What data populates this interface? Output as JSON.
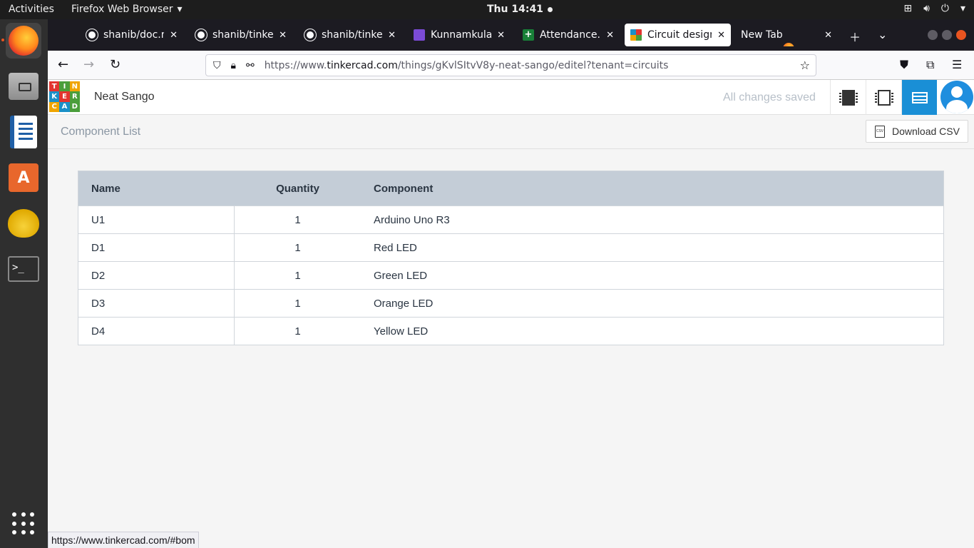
{
  "gnome": {
    "activities": "Activities",
    "app_name": "Firefox Web Browser",
    "clock": "Thu 14:41"
  },
  "tabs": [
    {
      "label": "",
      "icon": "firefox-icon"
    },
    {
      "label": "shanib/doc.md",
      "icon": "github-icon"
    },
    {
      "label": "shanib/tinkercad",
      "icon": "github-icon"
    },
    {
      "label": "shanib/tinkercad",
      "icon": "github-icon"
    },
    {
      "label": "Kunnamkulam",
      "icon": "forms-icon"
    },
    {
      "label": "Attendance.xlsx",
      "icon": "sheets-icon"
    },
    {
      "label": "Circuit design",
      "icon": "tinkercad-icon"
    },
    {
      "label": "New Tab",
      "icon": "firefox-icon"
    }
  ],
  "url": {
    "prefix": "https://www.",
    "domain": "tinkercad.com",
    "path": "/things/gKvlSItvV8y-neat-sango/editel?tenant=circuits"
  },
  "header": {
    "logo_letters": [
      "T",
      "I",
      "N",
      "K",
      "E",
      "R",
      "C",
      "A",
      "D"
    ],
    "logo_colors": [
      "#e3342f",
      "#4a9e3b",
      "#f0a500",
      "#1b90c7",
      "#e3342f",
      "#4a9e3b",
      "#f0a500",
      "#1b90c7",
      "#4a9e3b"
    ],
    "project_name": "Neat Sango",
    "save_status": "All changes saved"
  },
  "bom": {
    "title": "Component List",
    "download_label": "Download CSV",
    "columns": [
      "Name",
      "Quantity",
      "Component"
    ],
    "rows": [
      {
        "name": "U1",
        "qty": "1",
        "component": "Arduino Uno R3"
      },
      {
        "name": "D1",
        "qty": "1",
        "component": "Red LED"
      },
      {
        "name": "D2",
        "qty": "1",
        "component": "Green LED"
      },
      {
        "name": "D3",
        "qty": "1",
        "component": "Orange LED"
      },
      {
        "name": "D4",
        "qty": "1",
        "component": "Yellow LED"
      }
    ]
  },
  "status_link": "https://www.tinkercad.com/#bom",
  "colors": {
    "accent": "#1a8fd6",
    "table_header": "#c4cdd7",
    "ubuntu_orange": "#e95420"
  }
}
